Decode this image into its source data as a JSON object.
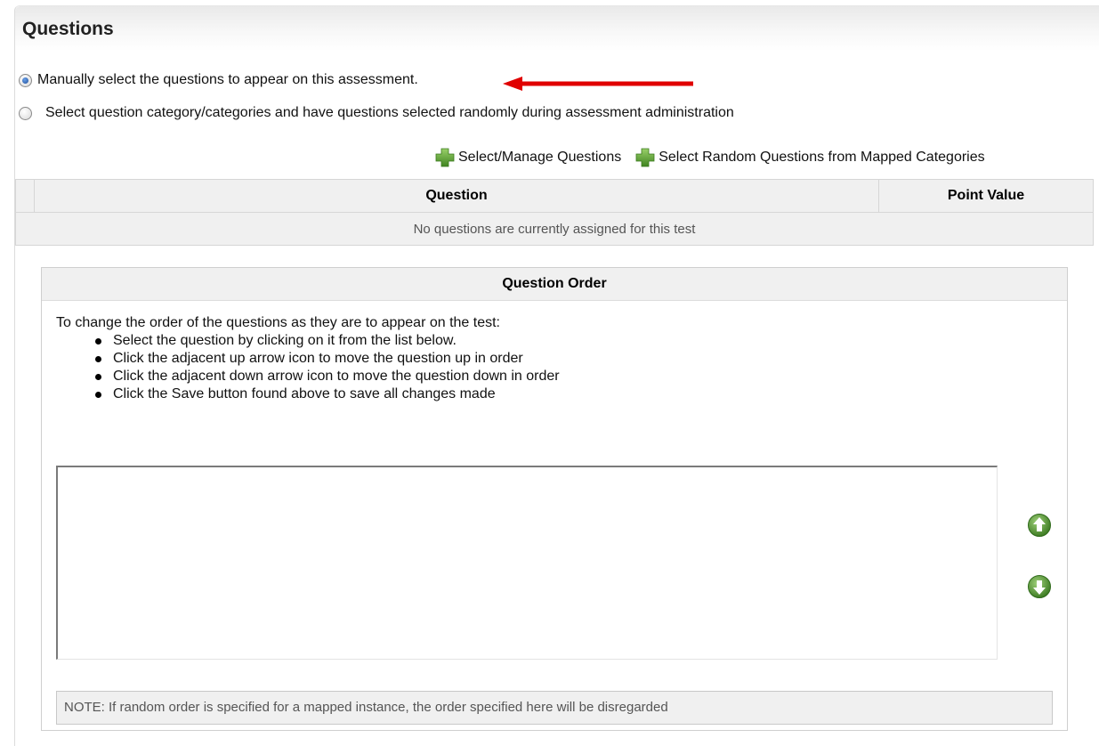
{
  "section": {
    "title": "Questions"
  },
  "options": [
    {
      "label": "Manually select the questions to appear on this assessment.",
      "selected": true
    },
    {
      "label": "Select question category/categories and have questions selected randomly during assessment administration",
      "selected": false
    }
  ],
  "actions": {
    "select_manage": "Select/Manage Questions",
    "select_random": "Select Random Questions from Mapped Categories"
  },
  "table": {
    "headers": [
      "Question",
      "Point Value"
    ],
    "empty_message": "No questions are currently assigned for this test"
  },
  "question_order": {
    "title": "Question Order",
    "intro": "To change the order of the questions as they are to appear on the test:",
    "steps": [
      "Select the question by clicking on it from the list below.",
      "Click the adjacent up arrow icon to move the question up in order",
      "Click the adjacent down arrow icon to move the question down in order",
      "Click the Save button found above to save all changes made"
    ],
    "note": "NOTE: If random order is specified for a mapped instance, the order specified here will be disregarded"
  },
  "icons": {
    "plus": "green-plus-icon",
    "up": "arrow-up-circle-icon",
    "down": "arrow-down-circle-icon",
    "annotation": "red-arrow-annotation"
  },
  "colors": {
    "icon_green": "#5a9a32",
    "annotation_red": "#e00000",
    "header_gray": "#f0f0f0"
  }
}
